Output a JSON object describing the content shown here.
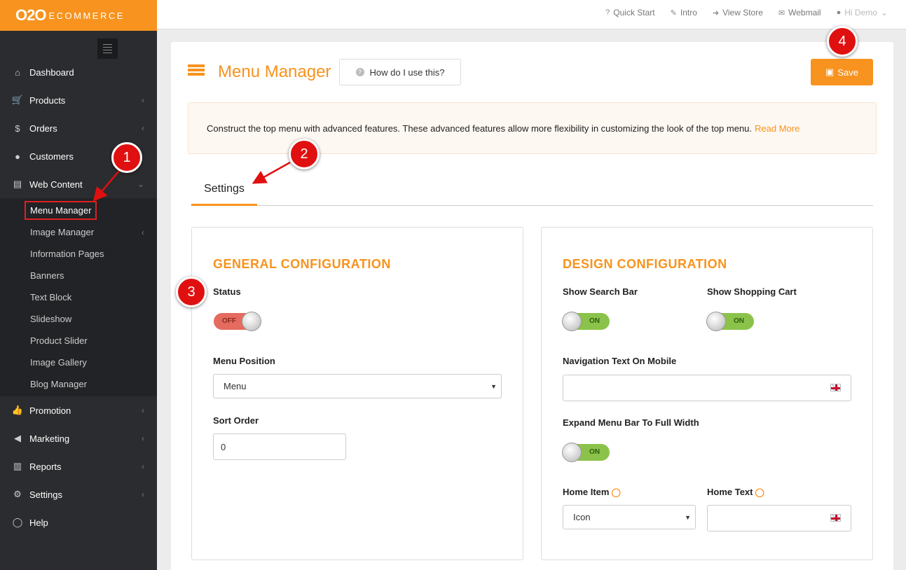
{
  "logo": {
    "brand": "O2O",
    "sub": "ECOMMERCE"
  },
  "sidebar": {
    "items": [
      {
        "label": "Dashboard",
        "icon": "home-icon",
        "glyph": "⌂"
      },
      {
        "label": "Products",
        "icon": "cart-icon",
        "glyph": "🛒"
      },
      {
        "label": "Orders",
        "icon": "dollar-icon",
        "glyph": "$"
      },
      {
        "label": "Customers",
        "icon": "user-icon",
        "glyph": "👤"
      },
      {
        "label": "Web Content",
        "icon": "book-icon",
        "glyph": "📘"
      }
    ],
    "submenu": [
      {
        "label": "Menu Manager"
      },
      {
        "label": "Image Manager"
      },
      {
        "label": "Information Pages"
      },
      {
        "label": "Banners"
      },
      {
        "label": "Text Block"
      },
      {
        "label": "Slideshow"
      },
      {
        "label": "Product Slider"
      },
      {
        "label": "Image Gallery"
      },
      {
        "label": "Blog Manager"
      }
    ],
    "items2": [
      {
        "label": "Promotion",
        "icon": "thumbs-up-icon",
        "glyph": "👍"
      },
      {
        "label": "Marketing",
        "icon": "megaphone-icon",
        "glyph": "📢"
      },
      {
        "label": "Reports",
        "icon": "bar-chart-icon",
        "glyph": "▥"
      },
      {
        "label": "Settings",
        "icon": "gears-icon",
        "glyph": "⚙"
      },
      {
        "label": "Help",
        "icon": "comment-icon",
        "glyph": "💬"
      }
    ]
  },
  "topnav": {
    "quick_start": "Quick Start",
    "intro": "Intro",
    "view_store": "View Store",
    "webmail": "Webmail",
    "user": "Hi Demo"
  },
  "page": {
    "title": "Menu Manager",
    "help_label": "How do I use this?",
    "save_label": "Save",
    "info_text": "Construct the top menu with advanced features. These advanced features allow more flexibility in customizing the look of the top menu.",
    "read_more": "Read More",
    "tab_settings": "Settings"
  },
  "general": {
    "heading": "GENERAL CONFIGURATION",
    "status_label": "Status",
    "status_value": "OFF",
    "menu_position_label": "Menu Position",
    "menu_position_value": "Menu",
    "sort_order_label": "Sort Order",
    "sort_order_value": "0"
  },
  "design": {
    "heading": "DESIGN CONFIGURATION",
    "show_search_label": "Show Search Bar",
    "show_search_value": "ON",
    "show_cart_label": "Show Shopping Cart",
    "show_cart_value": "ON",
    "nav_text_label": "Navigation Text On Mobile",
    "nav_text_value": "",
    "expand_label": "Expand Menu Bar To Full Width",
    "expand_value": "ON",
    "home_item_label": "Home Item",
    "home_item_value": "Icon",
    "home_text_label": "Home Text",
    "home_text_value": ""
  },
  "annotations": [
    "1",
    "2",
    "3",
    "4"
  ],
  "colors": {
    "accent": "#f7931e",
    "sidebar_bg": "#2b2c2f",
    "annotation": "#e01010"
  }
}
